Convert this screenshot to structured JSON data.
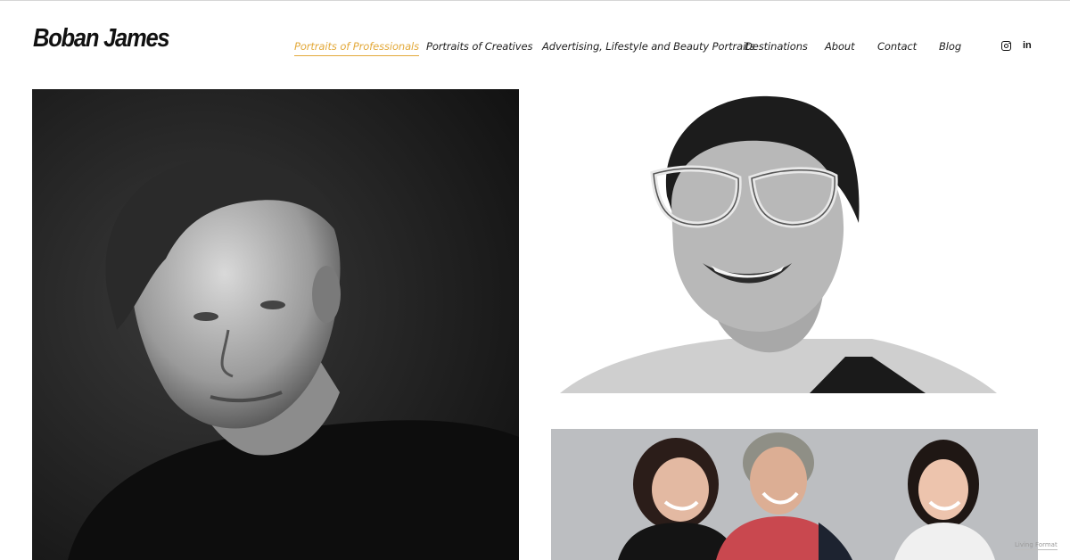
{
  "site": {
    "logo": "Boban James"
  },
  "nav": {
    "items": [
      {
        "label": "Portraits of Professionals",
        "active": true
      },
      {
        "label": "Portraits of Creatives",
        "active": false
      },
      {
        "label": "Advertising, Lifestyle and Beauty Portraits",
        "active": false
      },
      {
        "label": "Destinations",
        "active": false
      },
      {
        "label": "About",
        "active": false
      },
      {
        "label": "Contact",
        "active": false
      },
      {
        "label": "Blog",
        "active": false
      }
    ],
    "social": [
      {
        "icon": "instagram-icon"
      },
      {
        "icon": "linkedin-icon",
        "glyph": "in"
      }
    ]
  },
  "gallery": {
    "images": [
      {
        "subject": "black-and-white portrait of a man"
      },
      {
        "subject": "black-and-white portrait of a smiling woman with glasses"
      },
      {
        "subject": "colour portrait of three laughing women"
      }
    ]
  },
  "badge": "Living Format",
  "colors": {
    "accent": "#e3a93a",
    "text": "#111111",
    "background": "#ffffff"
  }
}
